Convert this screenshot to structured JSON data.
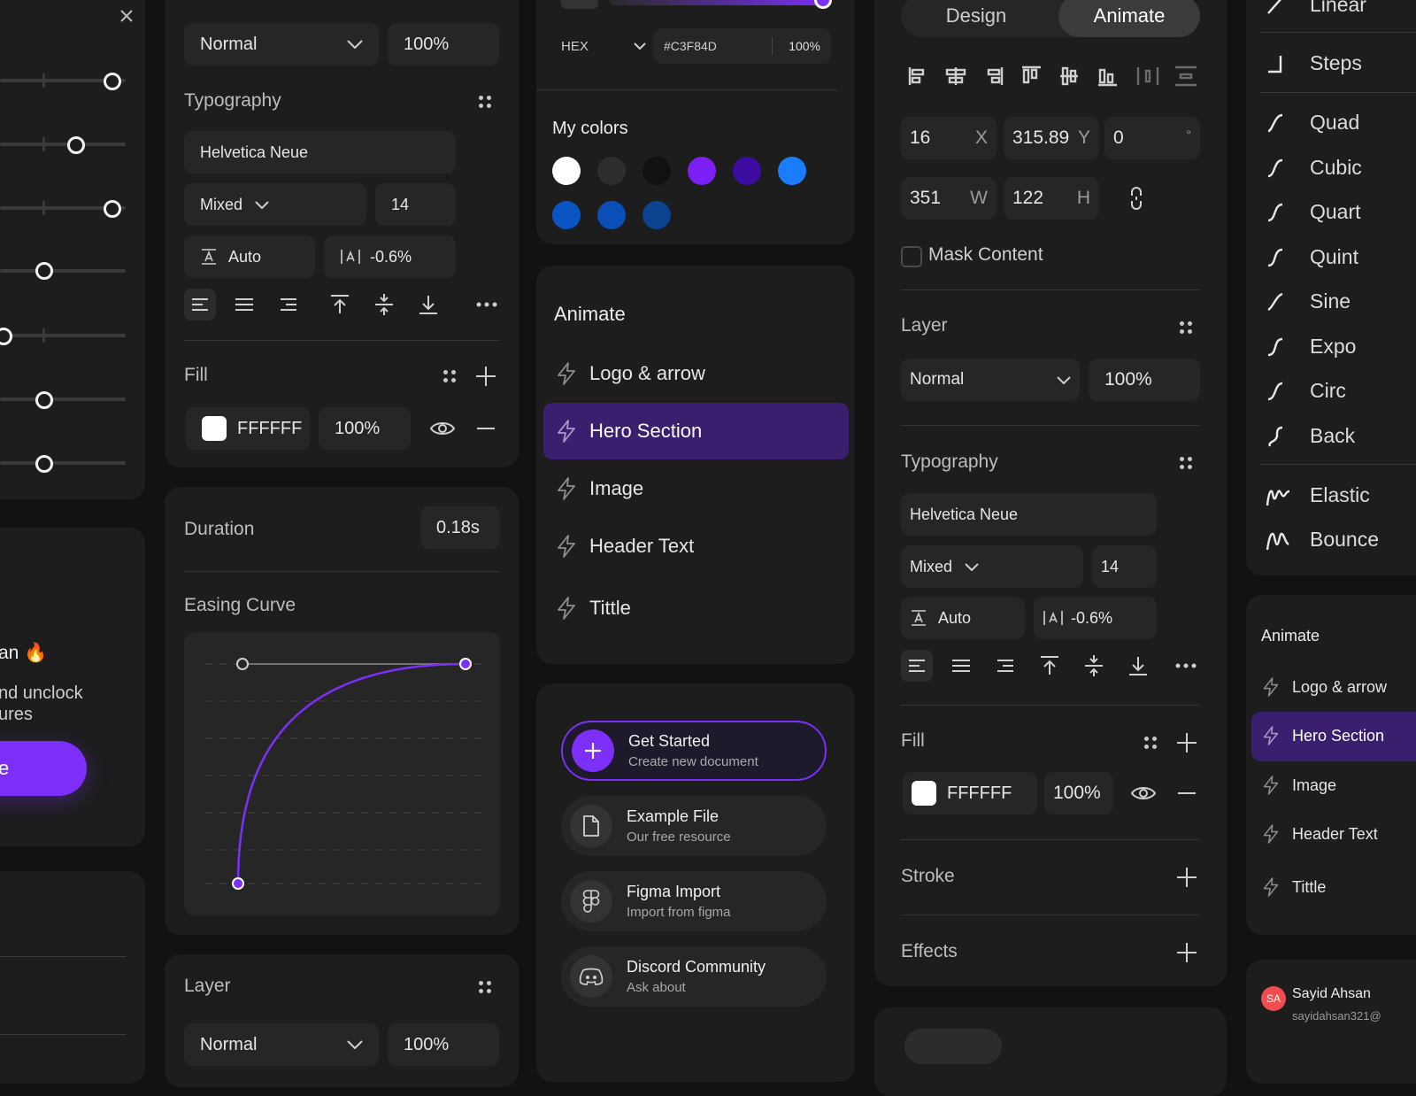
{
  "colors": {
    "accent": "#7B2FF7",
    "accent_dark": "#3A1F6E",
    "bg": "#121212",
    "card": "#1d1d1d",
    "field": "#262626"
  },
  "col1": {
    "promo_line1": "an 🔥",
    "promo_line2": "nd unclock",
    "promo_line3": "ures",
    "promo_button": "e"
  },
  "col2": {
    "blend_mode": "Normal",
    "opacity": "100%",
    "typography_title": "Typography",
    "font_family": "Helvetica Neue",
    "font_weight": "Mixed",
    "font_size": "14",
    "line_height": "Auto",
    "letter_spacing": "-0.6%",
    "fill_title": "Fill",
    "fill_hex": "FFFFFF",
    "fill_opacity": "100%",
    "duration_label": "Duration",
    "duration_value": "0.18s",
    "easing_label": "Easing Curve",
    "layer_title": "Layer",
    "layer_blend": "Normal",
    "layer_opacity": "100%"
  },
  "col3": {
    "color_format": "HEX",
    "color_hex": "#C3F84D",
    "color_opacity": "100%",
    "my_colors_title": "My colors",
    "swatches": [
      "#ffffff",
      "#2e2e2e",
      "#111111",
      "#7B1FF5",
      "#3C0BA0",
      "#1A7CFF",
      "#0A55C4",
      "#0A4FB8",
      "#0B4390"
    ],
    "animate_title": "Animate",
    "animate_items": [
      "Logo & arrow",
      "Hero Section",
      "Image",
      "Header Text",
      "Tittle"
    ],
    "actions": [
      {
        "title": "Get Started",
        "subtitle": "Create new document",
        "icon": "plus-icon"
      },
      {
        "title": "Example File",
        "subtitle": "Our free resource",
        "icon": "file-icon"
      },
      {
        "title": "Figma Import",
        "subtitle": "Import from figma",
        "icon": "figma-icon"
      },
      {
        "title": "Discord Community",
        "subtitle": "Ask about",
        "icon": "discord-icon"
      }
    ]
  },
  "col4": {
    "tabs": [
      "Design",
      "Animate"
    ],
    "x": "16",
    "x_label": "X",
    "y": "315.89",
    "y_label": "Y",
    "rotation": "0",
    "rotation_unit": "°",
    "w": "351",
    "w_label": "W",
    "h": "122",
    "h_label": "H",
    "mask_label": "Mask Content",
    "layer_title": "Layer",
    "blend": "Normal",
    "opacity": "100%",
    "typography_title": "Typography",
    "font_family": "Helvetica Neue",
    "font_weight": "Mixed",
    "font_size": "14",
    "line_height": "Auto",
    "letter_spacing": "-0.6%",
    "fill_title": "Fill",
    "fill_hex": "FFFFFF",
    "fill_opacity": "100%",
    "stroke_title": "Stroke",
    "effects_title": "Effects"
  },
  "col5": {
    "easings": [
      "Linear",
      "Steps",
      "Quad",
      "Cubic",
      "Quart",
      "Quint",
      "Sine",
      "Expo",
      "Circ",
      "Back",
      "Elastic",
      "Bounce"
    ],
    "animate_title": "Animate",
    "animate_items": [
      "Logo & arrow",
      "Hero Section",
      "Image",
      "Header Text",
      "Tittle"
    ],
    "user_initials": "SA",
    "user_name": "Sayid Ahsan",
    "user_email": "sayidahsan321@"
  }
}
